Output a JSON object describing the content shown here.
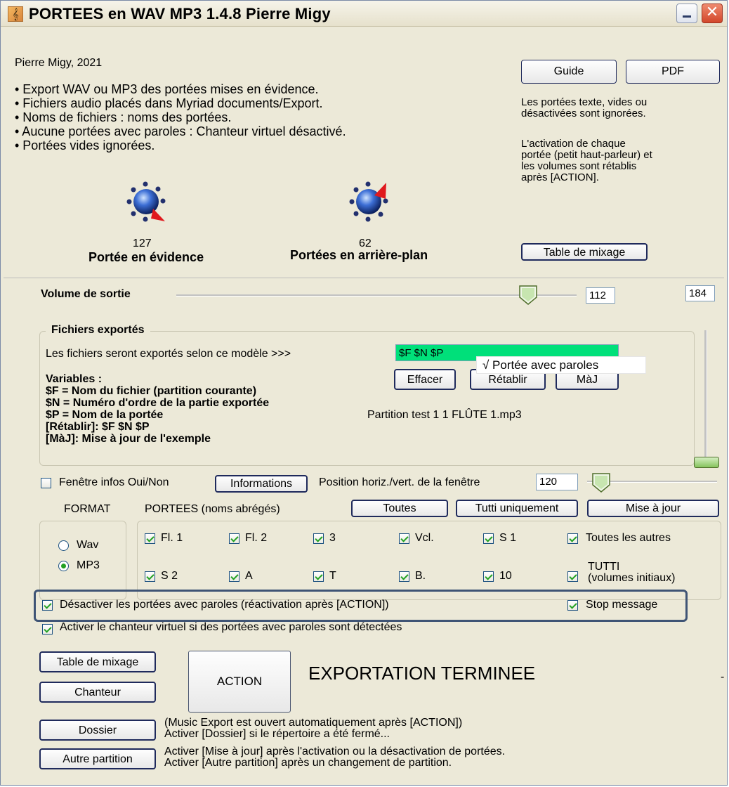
{
  "window": {
    "title": "PORTEES en WAV MP3 1.4.8 Pierre Migy",
    "minimize_label": "_",
    "close_label": "✕"
  },
  "header": {
    "author": "Pierre Migy, 2021",
    "bullets": [
      "• Export WAV ou MP3 des portées mises en évidence.",
      "• Fichiers audio placés dans Myriad documents/Export.",
      "• Noms de fichiers : noms des portées.",
      "• Aucune portées avec paroles : Chanteur virtuel désactivé.",
      "• Portées vides ignorées."
    ]
  },
  "top_right": {
    "guide_label": "Guide",
    "pdf_label": "PDF",
    "note1": [
      "Les portées texte, vides ou",
      "désactivées sont ignorées."
    ],
    "note2": [
      "L'activation de chaque",
      "portée (petit haut-parleur) et",
      "les volumes sont  rétablis",
      "après [ACTION]."
    ],
    "mixer_label": "Table de mixage"
  },
  "knobs": {
    "foreground_value": "127",
    "foreground_label": "Portée en évidence",
    "background_value": "62",
    "background_label": "Portées en arrière-plan"
  },
  "volume": {
    "label": "Volume de sortie",
    "value": "112",
    "level": 0.6,
    "extra_value": "184"
  },
  "export_files": {
    "group_title": "Fichiers exportés",
    "model_label": "Les fichiers seront exportés selon ce modèle >>>",
    "model_value": "$F $N $P",
    "menu_item": "√ Portée avec paroles",
    "vars_title": "Variables :",
    "vars": [
      "$F = Nom du fichier (partition courante)",
      "$N = Numéro d'ordre de la partie exportée",
      "$P = Nom de la portée",
      "[Rétablir]: $F $N $P",
      "[MàJ]: Mise à jour de l'exemple"
    ],
    "clear_label": "Effacer",
    "restore_label": "Rétablir",
    "update_label": "MàJ",
    "example": "Partition test 1 1 FLÛTE 1.mp3"
  },
  "window_info": {
    "checkbox_label": "Fenêtre infos Oui/Non",
    "info_button": "Informations",
    "position_label": "Position horiz./vert. de la fenêtre",
    "position_value": "120"
  },
  "format": {
    "title": "FORMAT",
    "options": [
      "Wav",
      "MP3"
    ],
    "selected": "MP3"
  },
  "portees": {
    "title": "PORTEES (noms abrégés)",
    "all_label": "Toutes",
    "tutti_label": "Tutti uniquement",
    "update_label": "Mise à jour",
    "row1": [
      "Fl. 1",
      "Fl. 2",
      "3",
      "Vcl.",
      "S 1",
      "Toutes les autres"
    ],
    "row2": [
      "S 2",
      "A",
      "T",
      "B.",
      "10"
    ],
    "tutti_main": "TUTTI",
    "tutti_sub": "(volumes initiaux)"
  },
  "options": {
    "deactivate_label": "Désactiver les portées avec paroles (réactivation après [ACTION])",
    "stop_label": "Stop message",
    "singer_label": "Activer le chanteur virtuel si des portées avec paroles sont détectées"
  },
  "bottom": {
    "mixer_label": "Table de mixage",
    "singer_label": "Chanteur",
    "folder_label": "Dossier",
    "other_label": "Autre partition",
    "action_label": "ACTION",
    "status": "EXPORTATION TERMINEE",
    "dash": "-",
    "note1": [
      "(Music Export est ouvert automatiquement après [ACTION])",
      "Activer [Dossier] si le répertoire a été fermé..."
    ],
    "note2": [
      "Activer [Mise à jour] après l'activation ou la désactivation de portées.",
      "Activer [Autre partition] après un changement de partition."
    ]
  },
  "colors": {
    "window_bg": "#ece9d8",
    "model_field_bg": "#00e07a",
    "highlight_border": "#3f5475",
    "close_button": "#d2462a"
  }
}
